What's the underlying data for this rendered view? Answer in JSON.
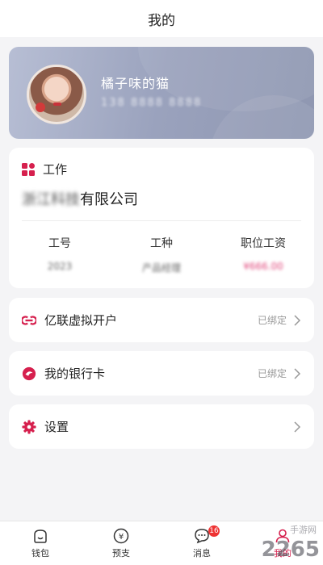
{
  "header": {
    "title": "我的"
  },
  "profile": {
    "name": "橘子味的猫",
    "phone": "138 8888 8888"
  },
  "work": {
    "title": "工作",
    "company_blur": "浙江科技",
    "company_suffix": "有限公司",
    "columns": [
      {
        "label": "工号",
        "value": "2023"
      },
      {
        "label": "工种",
        "value": "产品经理"
      },
      {
        "label": "职位工资",
        "value": "¥666.00"
      }
    ]
  },
  "menu": [
    {
      "label": "亿联虚拟开户",
      "status": "已绑定",
      "icon": "link-icon"
    },
    {
      "label": "我的银行卡",
      "status": "已绑定",
      "icon": "bank-card-icon"
    },
    {
      "label": "设置",
      "status": "",
      "icon": "gear-icon"
    }
  ],
  "tabs": [
    {
      "label": "钱包",
      "icon": "wallet-icon"
    },
    {
      "label": "预支",
      "icon": "advance-icon"
    },
    {
      "label": "消息",
      "icon": "message-icon",
      "badge": "16"
    },
    {
      "label": "我的",
      "icon": "user-icon",
      "active": true
    }
  ],
  "watermark": {
    "main": "2265",
    "sub": "手游网"
  },
  "colors": {
    "accent": "#d6204e",
    "profile_bg": "#9aa2bd"
  }
}
